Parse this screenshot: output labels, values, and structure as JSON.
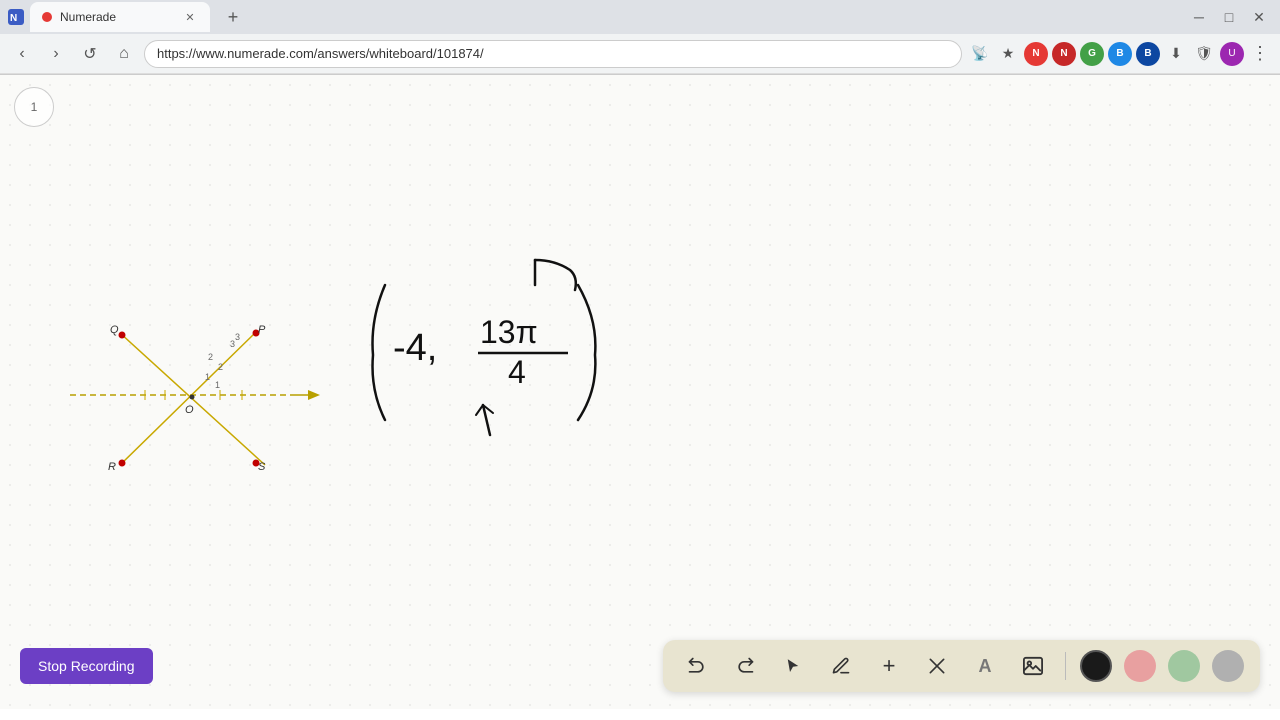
{
  "browser": {
    "tab_title": "Numerade",
    "url": "https://www.numerade.com/answers/whiteboard/101874/",
    "favicon": "N",
    "new_tab_label": "+",
    "window_controls": [
      "─",
      "□",
      "✕"
    ]
  },
  "nav": {
    "back_label": "‹",
    "forward_label": "›",
    "refresh_label": "↺",
    "home_label": "⌂"
  },
  "page": {
    "page_number": "1"
  },
  "toolbar": {
    "undo_label": "↩",
    "redo_label": "↪",
    "select_label": "▶",
    "pen_label": "✏",
    "add_label": "+",
    "eraser_label": "/",
    "text_label": "A",
    "image_label": "🖼",
    "colors": {
      "black": "#1a1a1a",
      "pink": "#e8a0a0",
      "green": "#a0c8a0",
      "gray": "#b0b0b0"
    }
  },
  "bottom_bar": {
    "stop_recording_label": "Stop Recording"
  }
}
